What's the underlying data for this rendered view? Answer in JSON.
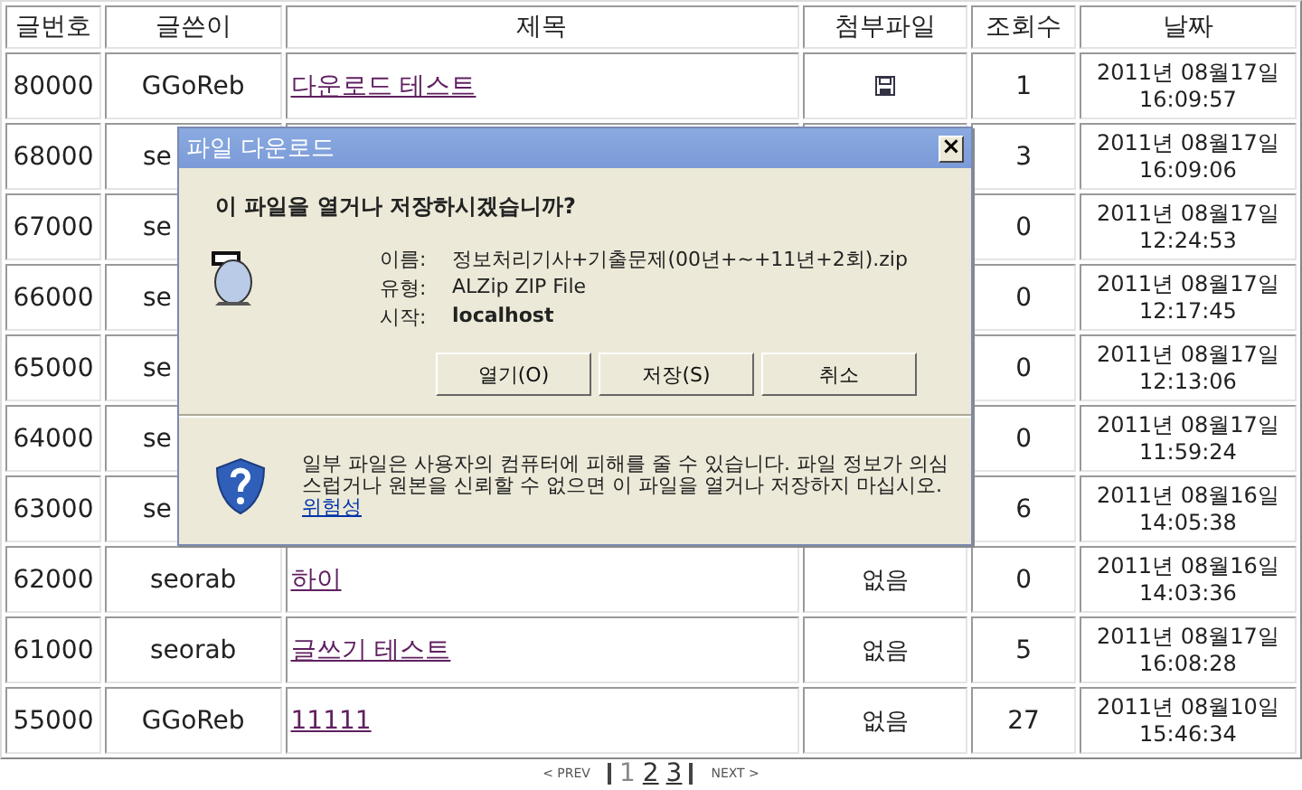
{
  "table": {
    "columns": [
      "글번호",
      "글쓴이",
      "제목",
      "첨부파일",
      "조회수",
      "날짜"
    ],
    "rows": [
      {
        "number": "80000",
        "writer": "GGoReb",
        "title": "다운로드 테스트",
        "attachment": {
          "kind": "file"
        },
        "views": "1",
        "date": "2011년 08월17일 16:09:57"
      },
      {
        "number": "68000",
        "writer": "se",
        "views": "3",
        "date": "2011년 08월17일 16:09:06"
      },
      {
        "number": "67000",
        "writer": "se",
        "views": "0",
        "date": "2011년 08월17일 12:24:53"
      },
      {
        "number": "66000",
        "writer": "se",
        "views": "0",
        "date": "2011년 08월17일 12:17:45"
      },
      {
        "number": "65000",
        "writer": "se",
        "views": "0",
        "date": "2011년 08월17일 12:13:06"
      },
      {
        "number": "64000",
        "writer": "se",
        "views": "0",
        "date": "2011년 08월17일 11:59:24"
      },
      {
        "number": "63000",
        "writer": "se",
        "views": "6",
        "date": "2011년 08월16일 14:05:38"
      },
      {
        "number": "62000",
        "writer": "seorab",
        "title": "하이",
        "attachment": {
          "kind": "none",
          "text": "없음"
        },
        "views": "0",
        "date": "2011년 08월16일 14:03:36"
      },
      {
        "number": "61000",
        "writer": "seorab",
        "title": "글쓰기 테스트",
        "attachment": {
          "kind": "none",
          "text": "없음"
        },
        "views": "5",
        "date": "2011년 08월17일 16:08:28"
      },
      {
        "number": "55000",
        "writer": "GGoReb",
        "title": "11111",
        "attachment": {
          "kind": "none",
          "text": "없음"
        },
        "views": "27",
        "date": "2011년 08월10일 15:46:34"
      }
    ]
  },
  "pager": {
    "prev": "< PREV",
    "pages": [
      {
        "label": "1",
        "selected": true
      },
      {
        "label": "2",
        "selected": false
      },
      {
        "label": "3",
        "selected": false
      }
    ],
    "next": "NEXT >"
  },
  "dialog": {
    "title": "파일 다운로드",
    "close": "×",
    "question": "이 파일을 열거나 저장하시겠습니까?",
    "fields": [
      {
        "label": "이름:",
        "value": "정보처리기사+기출문제(00년+~+11년+2회).zip",
        "bold": false
      },
      {
        "label": "유형:",
        "value": "ALZip ZIP File",
        "bold": false
      },
      {
        "label": "시작:",
        "value": "localhost",
        "bold": true
      }
    ],
    "buttons": [
      "열기(O)",
      "저장(S)",
      "취소"
    ],
    "warning": "일부 파일은 사용자의 컴퓨터에 피해를 줄 수 있습니다. 파일 정보가 의심스럽거나 원본을 신뢰할 수 없으면 이 파일을 열거나 저장하지 마십시오.",
    "warning_link": "위험성"
  }
}
